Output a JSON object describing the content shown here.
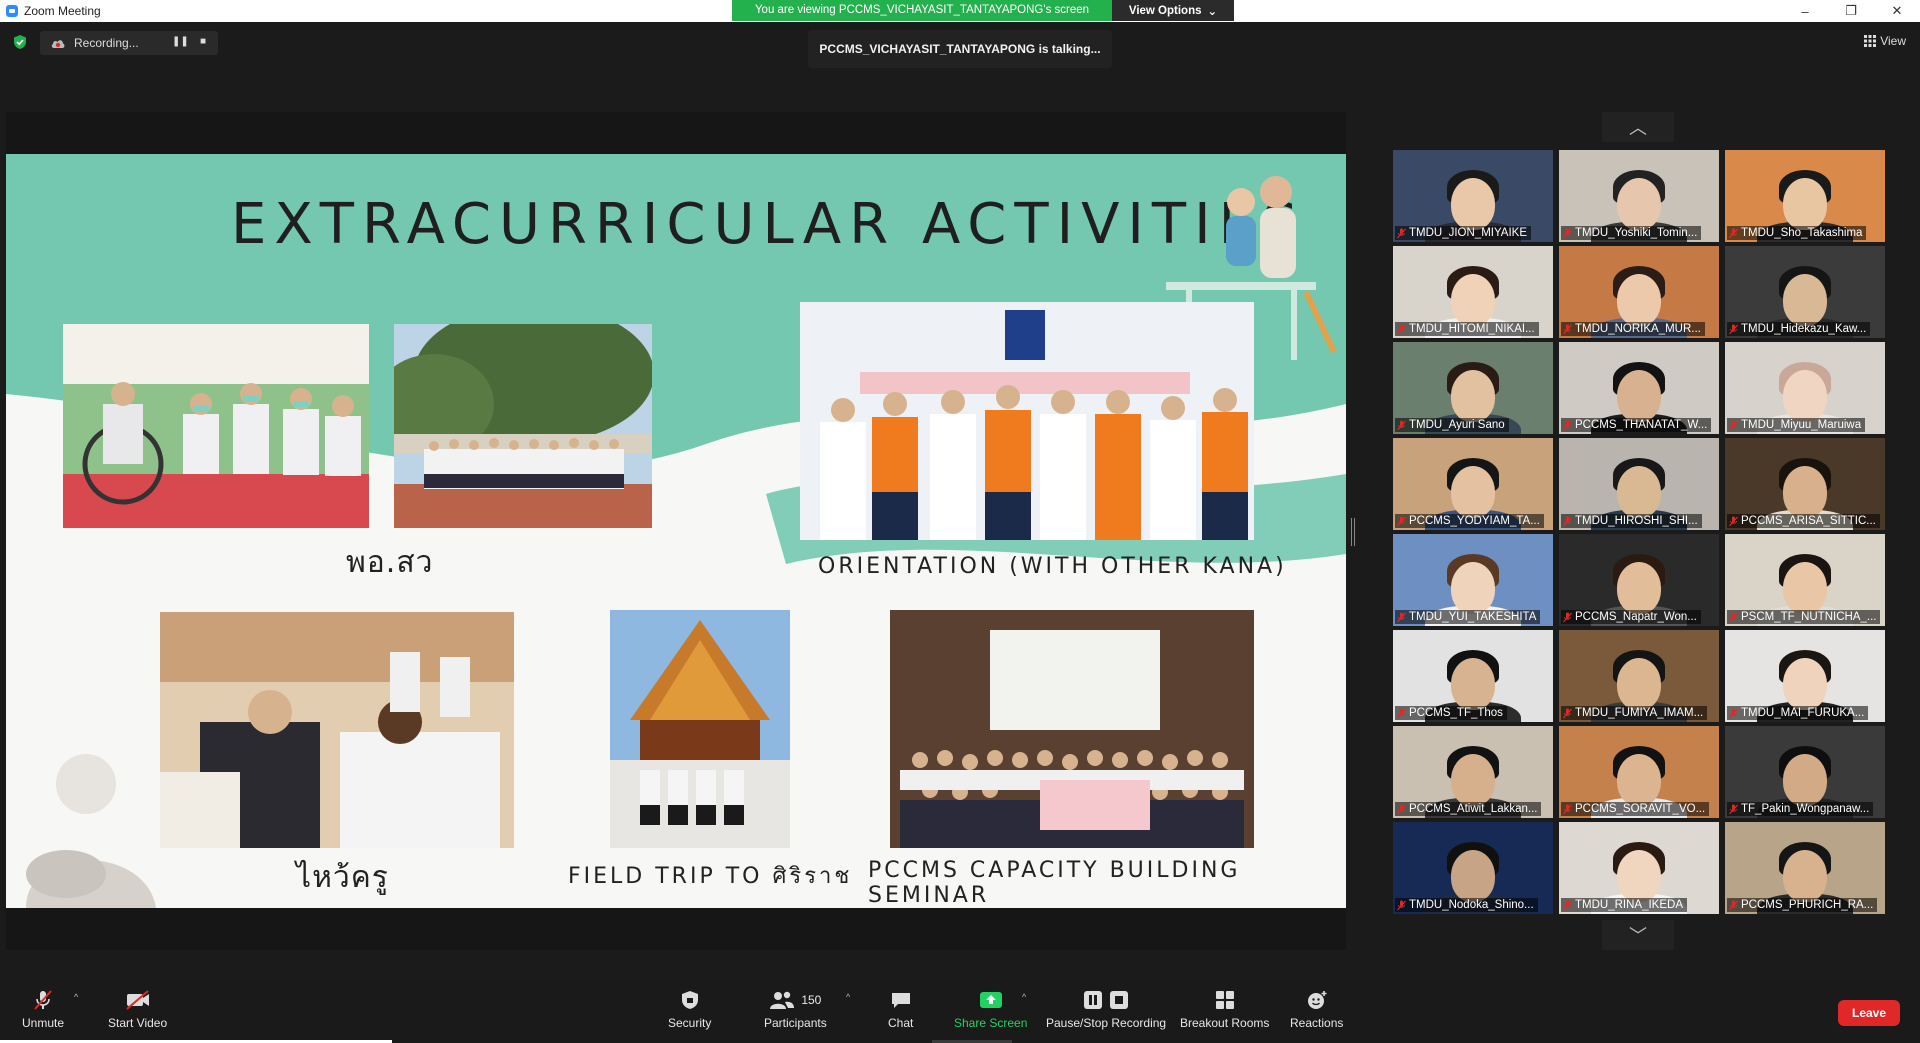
{
  "window": {
    "title": "Zoom Meeting",
    "controls": [
      "–",
      "❐",
      "✕"
    ]
  },
  "banner": {
    "viewing_text": "You are viewing PCCMS_VICHAYASIT_TANTAYAPONG's screen",
    "view_options_label": "View Options"
  },
  "recording": {
    "label": "Recording..."
  },
  "talking": {
    "text": "PCCMS_VICHAYASIT_TANTAYAPONG is talking..."
  },
  "view_button": {
    "label": "View"
  },
  "slide": {
    "title": "EXTRACURRICULAR ACTIVITIES",
    "captions": {
      "por_sor_wor": "พอ.สว",
      "orientation": "ORIENTATION (WITH OTHER KANA)",
      "wai_kru": "ไหว้ครู",
      "field_trip": "FIELD TRIP TO ศิริราช",
      "seminar": "PCCMS CAPACITY BUILDING SEMINAR"
    }
  },
  "gallery": {
    "participants": [
      {
        "name": "TMDU_JION_MIYAIKE",
        "bg": "#3a4a66",
        "skin": "#e8c8a8",
        "hair": "#1a1a1a",
        "shirt": "#2a2a35"
      },
      {
        "name": "TMDU_Yoshiki_Tomin...",
        "bg": "#c9c2b8",
        "skin": "#e6c7ad",
        "hair": "#222",
        "shirt": "#3a3a3a"
      },
      {
        "name": "TMDU_Sho_Takashima",
        "bg": "#d98a4a",
        "skin": "#e9c6a2",
        "hair": "#1a1a1a",
        "shirt": "#2b2b2b"
      },
      {
        "name": "TMDU_HITOMI_NIKAI...",
        "bg": "#d8d4cc",
        "skin": "#efd2b8",
        "hair": "#2a1c14",
        "shirt": "#f0f0f0"
      },
      {
        "name": "TMDU_NORIKA_MUR...",
        "bg": "#c57a45",
        "skin": "#ecc9ab",
        "hair": "#2b1d15",
        "shirt": "#5a6a8a"
      },
      {
        "name": "TMDU_Hidekazu_Kaw...",
        "bg": "#3b3b3b",
        "skin": "#d9b895",
        "hair": "#151515",
        "shirt": "#2a2a2a"
      },
      {
        "name": "TMDU_Ayuri Sano",
        "bg": "#6a7f6e",
        "skin": "#e2c1a0",
        "hair": "#2a1c14",
        "shirt": "#384858"
      },
      {
        "name": "PCCMS_THANATAT_W...",
        "bg": "#cfcac3",
        "skin": "#d8b290",
        "hair": "#121212",
        "shirt": "#1c1c1c"
      },
      {
        "name": "TMDU_Miyuu_Maruiwa",
        "bg": "#d8d2cc",
        "skin": "#f0d6c2",
        "hair": "#c9a89a",
        "shirt": "#e9e4df"
      },
      {
        "name": "PCCMS_YODYIAM_TA...",
        "bg": "#c7a27a",
        "skin": "#e4c1a0",
        "hair": "#151515",
        "shirt": "#3a5580"
      },
      {
        "name": "TMDU_HIROSHI_SHI...",
        "bg": "#b9b5ae",
        "skin": "#d9b894",
        "hair": "#181818",
        "shirt": "#2a3a4a"
      },
      {
        "name": "PCCMS_ARISA_SITTIC...",
        "bg": "#4a3828",
        "skin": "#d8b08c",
        "hair": "#1a120c",
        "shirt": "#e2dccf"
      },
      {
        "name": "TMDU_YUI_TAKESHITA",
        "bg": "#6d8fc2",
        "skin": "#f0d3bb",
        "hair": "#5a3a24",
        "shirt": "#f2f2f2"
      },
      {
        "name": "PCCMS_Napatr_Won...",
        "bg": "#2a2a2a",
        "skin": "#e2bd9a",
        "hair": "#2a1a10",
        "shirt": "#555"
      },
      {
        "name": "PSCM_TF_NUTNICHA_...",
        "bg": "#d9d3c8",
        "skin": "#e8c6a6",
        "hair": "#1c1410",
        "shirt": "#e0ddd8"
      },
      {
        "name": "PCCMS_TF_Thos",
        "bg": "#e2e2e2",
        "skin": "#d7b391",
        "hair": "#111",
        "shirt": "#2c2c2c"
      },
      {
        "name": "TMDU_FUMIYA_IMAM...",
        "bg": "#7a5a3a",
        "skin": "#dcb690",
        "hair": "#141414",
        "shirt": "#3a3a3a"
      },
      {
        "name": "TMDU_MAI_FURUKA...",
        "bg": "#e6e4e2",
        "skin": "#efd3bd",
        "hair": "#1c1612",
        "shirt": "#222"
      },
      {
        "name": "PCCMS_Atiwit_Lakkan...",
        "bg": "#c9c0b2",
        "skin": "#d6b08c",
        "hair": "#121212",
        "shirt": "#3a3a3a"
      },
      {
        "name": "PCCMS_SORAVIT_VO...",
        "bg": "#c5814c",
        "skin": "#dcb490",
        "hair": "#121212",
        "shirt": "#e9e9e9"
      },
      {
        "name": "TF_Pakin_Wongpanaw...",
        "bg": "#3a3a3a",
        "skin": "#d2aa86",
        "hair": "#0e0e0e",
        "shirt": "#242424"
      },
      {
        "name": "TMDU_Nodoka_Shino...",
        "bg": "#162a55",
        "skin": "#c8a487",
        "hair": "#101010",
        "shirt": "#202a40"
      },
      {
        "name": "TMDU_RINA_IKEDA",
        "bg": "#ded8d2",
        "skin": "#f0d5bf",
        "hair": "#2a1a12",
        "shirt": "#f4f4f4"
      },
      {
        "name": "PCCMS_PHURICH_RA...",
        "bg": "#b8a488",
        "skin": "#d8b28e",
        "hair": "#151515",
        "shirt": "#2a2a2a"
      }
    ]
  },
  "toolbar": {
    "unmute": "Unmute",
    "start_video": "Start Video",
    "security": "Security",
    "participants": "Participants",
    "participants_count": "150",
    "chat": "Chat",
    "share_screen": "Share Screen",
    "pause_stop_recording": "Pause/Stop Recording",
    "breakout_rooms": "Breakout Rooms",
    "reactions": "Reactions",
    "leave": "Leave"
  },
  "colors": {
    "teal_band": "#74c8b0",
    "share_green": "#23d160",
    "viewing_banner": "#23b14d",
    "leave_red": "#e02828",
    "muted_red": "#e02828"
  }
}
